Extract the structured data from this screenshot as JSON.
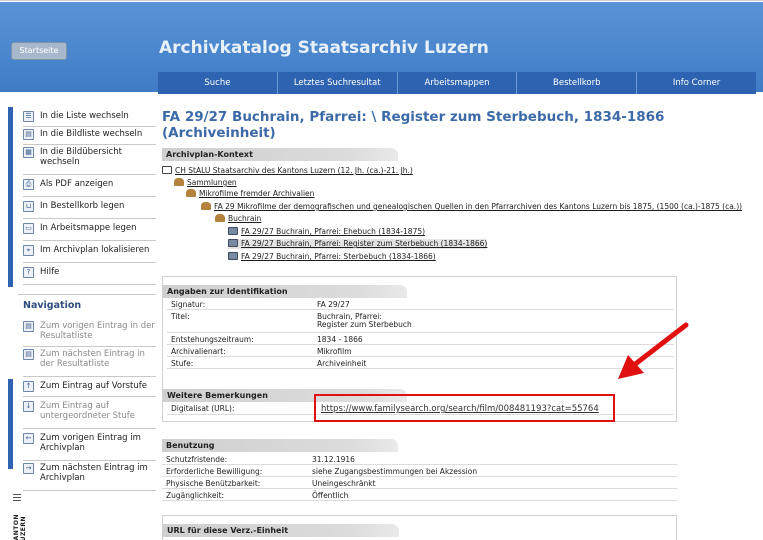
{
  "header": {
    "startseite": "Startseite",
    "title": "Archivkatalog Staatsarchiv Luzern",
    "nav": [
      "Suche",
      "Letztes Suchresultat",
      "Arbeitsmappen",
      "Bestellkorb",
      "Info Corner"
    ]
  },
  "sidebar": {
    "actions": [
      {
        "label": "In die Liste wechseln",
        "icon": "list-icon"
      },
      {
        "label": "In die Bildliste wechseln",
        "icon": "image-list-icon"
      },
      {
        "label": "In die Bildübersicht wechseln",
        "icon": "thumbnails-icon"
      },
      {
        "label": "Als PDF anzeigen",
        "icon": "pdf-icon"
      },
      {
        "label": "In Bestellkorb legen",
        "icon": "basket-icon"
      },
      {
        "label": "In Arbeitsmappe legen",
        "icon": "folder-icon"
      },
      {
        "label": "Im Archivplan lokalisieren",
        "icon": "locate-icon"
      },
      {
        "label": "Hilfe",
        "icon": "help-icon"
      }
    ],
    "navigation_heading": "Navigation",
    "navigation": [
      {
        "label": "Zum vorigen Eintrag in der Resultatliste",
        "icon": "prev-result-icon"
      },
      {
        "label": "Zum nächsten Eintrag in der Resultatliste",
        "icon": "next-result-icon"
      },
      {
        "label": "Zum Eintrag auf Vorstufe",
        "icon": "up-arrow-icon"
      },
      {
        "label": "Zum Eintrag auf untergeordneter Stufe",
        "icon": "down-arrow-icon"
      },
      {
        "label": "Zum vorigen Eintrag im Archivplan",
        "icon": "left-arrow-icon"
      },
      {
        "label": "Zum nächsten Eintrag im Archivplan",
        "icon": "right-arrow-icon"
      }
    ],
    "logo_text": "KANTON LUZERN"
  },
  "record": {
    "title_line1": "FA 29/27 Buchrain, Pfarrei: \\ Register zum Sterbebuch, 1834-1866",
    "title_line2": "(Archiveinheit)"
  },
  "archivplan": {
    "heading": "Archivplan-Kontext",
    "tree": [
      {
        "text": "CH StALU Staatsarchiv des Kantons Luzern (12. Jh. (ca.)-21. Jh.)",
        "icon": "house-icon"
      },
      {
        "text": "Sammlungen",
        "icon": "collection-icon"
      },
      {
        "text": "Mikrofilme fremder Archivalien",
        "icon": "collection-icon"
      },
      {
        "text": "FA 29 Mikrofilme der demografischen und genealogischen Quellen in den Pfarrarchiven des Kantons Luzern bis 1875, (1500 (ca.)-1875 (ca.))",
        "icon": "collection-icon"
      },
      {
        "text": "Buchrain",
        "icon": "collection-icon"
      },
      {
        "text": "FA 29/27 Buchrain, Pfarrei: Ehebuch (1834-1875)",
        "icon": "film-icon"
      },
      {
        "text": "FA 29/27 Buchrain, Pfarrei: Register zum Sterbebuch (1834-1866)",
        "icon": "film-icon"
      },
      {
        "text": "FA 29/27 Buchrain, Pfarrei: Sterbebuch (1834-1866)",
        "icon": "film-icon"
      }
    ]
  },
  "identifikation": {
    "heading": "Angaben zur Identifikation",
    "rows": [
      {
        "k": "Signatur:",
        "v": "FA 29/27"
      },
      {
        "k": "Titel:",
        "v": "Buchrain, Pfarrei:",
        "v2": "Register zum Sterbebuch"
      },
      {
        "k": "Entstehungszeitraum:",
        "v": "1834 - 1866"
      },
      {
        "k": "Archivalienart:",
        "v": "Mikrofilm"
      },
      {
        "k": "Stufe:",
        "v": "Archiveinheit"
      }
    ]
  },
  "bemerkungen": {
    "heading": "Weitere Bemerkungen",
    "label": "Digitalisat (URL):",
    "url": "https://www.familysearch.org/search/film/008481193?cat=55764"
  },
  "benutzung": {
    "heading": "Benutzung",
    "rows": [
      {
        "k": "Schutzfristende:",
        "v": "31.12.1916"
      },
      {
        "k": "Erforderliche Bewilligung:",
        "v": "siehe Zugangsbestimmungen bei Akzession"
      },
      {
        "k": "Physische Benützbarkeit:",
        "v": "Uneingeschränkt"
      },
      {
        "k": "Zugänglichkeit:",
        "v": "Öffentlich"
      }
    ]
  },
  "url_section": {
    "heading": "URL für diese Verz.-Einheit"
  },
  "colors": {
    "header_blue": "#4a87d0",
    "nav_blue": "#2d63b0",
    "title_blue": "#3c6aa8",
    "annotation_red": "#e01010"
  }
}
